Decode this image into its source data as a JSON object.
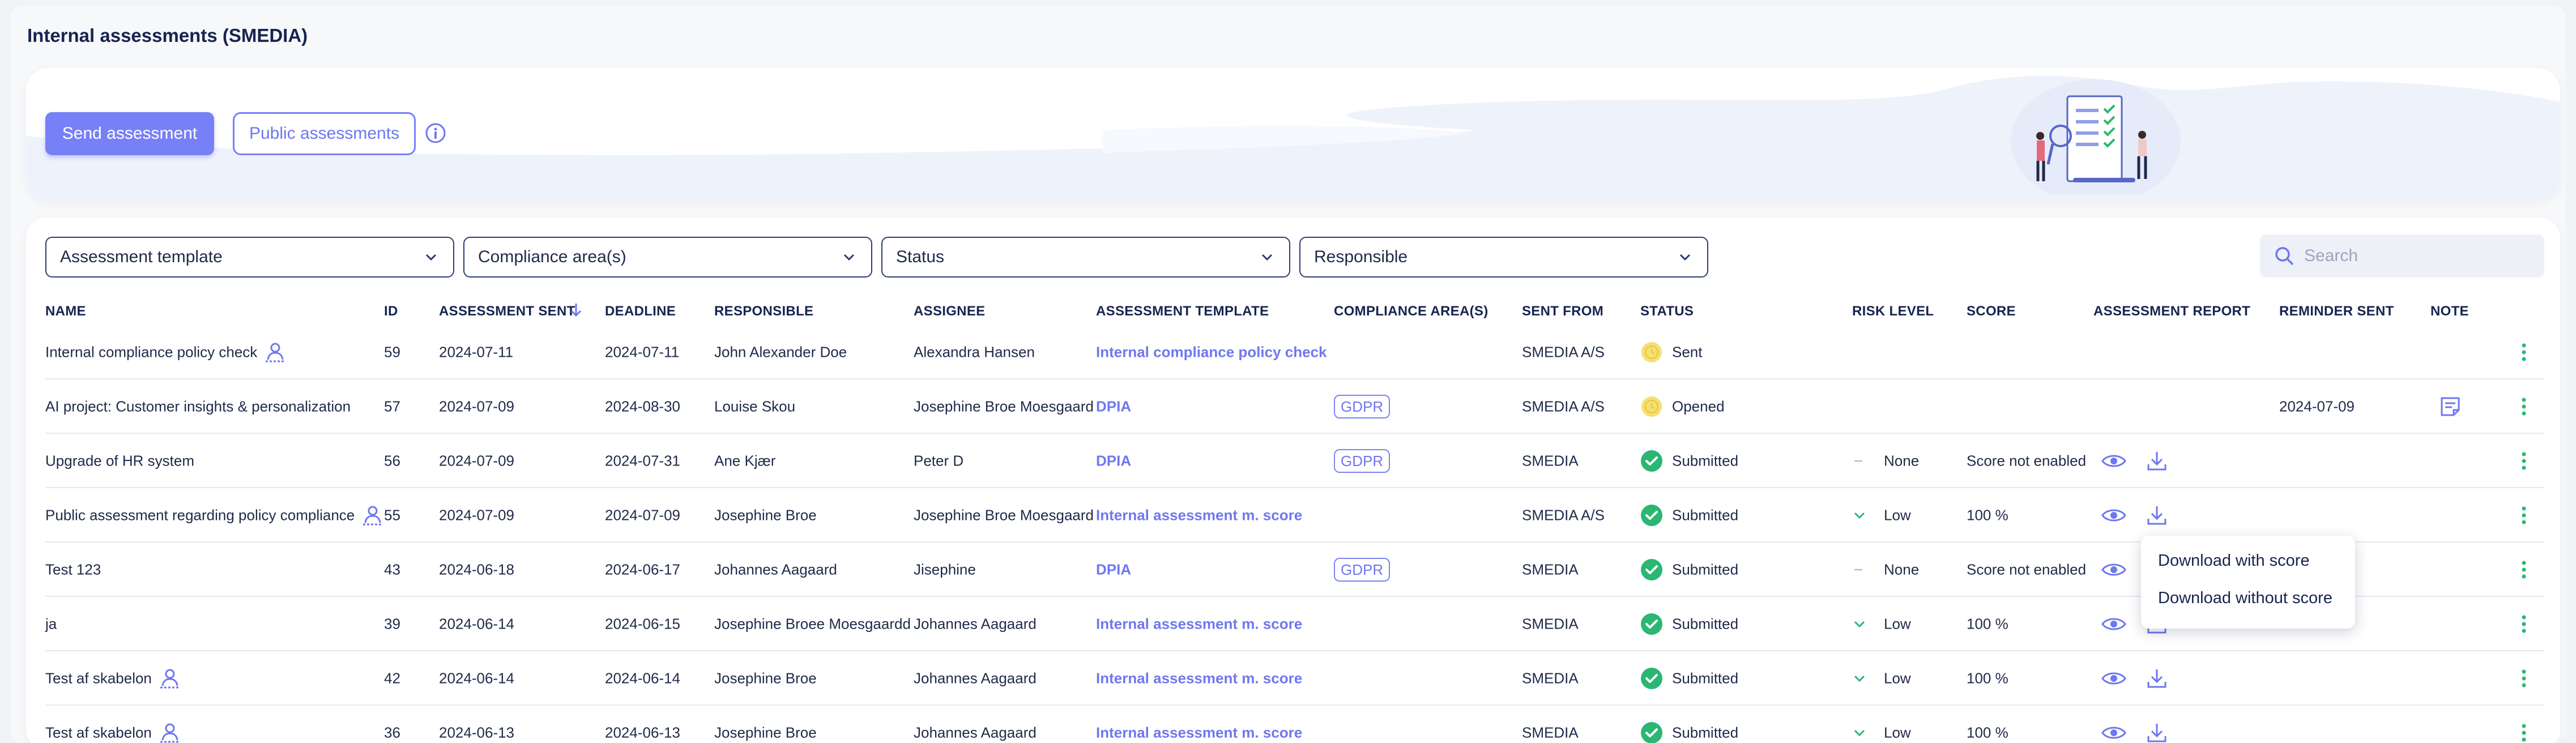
{
  "page": {
    "title": "Internal assessments (SMEDIA)"
  },
  "actions": {
    "send_label": "Send assessment",
    "public_label": "Public assessments"
  },
  "filters": {
    "template": "Assessment template",
    "compliance": "Compliance area(s)",
    "status": "Status",
    "responsible": "Responsible",
    "search_placeholder": "Search"
  },
  "columns": {
    "name": "NAME",
    "id": "ID",
    "sent": "ASSESSMENT SENT",
    "deadline": "DEADLINE",
    "responsible": "RESPONSIBLE",
    "assignee": "ASSIGNEE",
    "template": "ASSESSMENT TEMPLATE",
    "compliance": "COMPLIANCE AREA(S)",
    "sent_from": "SENT FROM",
    "status": "STATUS",
    "risk": "RISK LEVEL",
    "score": "SCORE",
    "report": "ASSESSMENT REPORT",
    "reminder": "REMINDER SENT",
    "note": "NOTE"
  },
  "colors": {
    "accent": "#7780f7",
    "link": "#6f78ef",
    "submitted": "#2bb673",
    "pending": "#f7df72",
    "heading": "#17244f"
  },
  "rows": [
    {
      "name": "Internal compliance policy check",
      "public_icon": "public-user-icon",
      "id": "59",
      "sent": "2024-07-11",
      "deadline": "2024-07-11",
      "responsible": "John Alexander Doe",
      "assignee": "Alexandra Hansen",
      "template": "Internal compliance policy check",
      "compliance": "",
      "sent_from": "SMEDIA A/S",
      "status": "Sent",
      "status_icon": "clock-icon",
      "risk": "",
      "risk_icon": "",
      "score": "",
      "report": false,
      "reminder": "",
      "note": false
    },
    {
      "name": "AI project: Customer insights & personalization",
      "public_icon": "",
      "id": "57",
      "sent": "2024-07-09",
      "deadline": "2024-08-30",
      "responsible": "Louise Skou",
      "assignee": "Josephine Broe Moesgaard",
      "template": "DPIA",
      "compliance": "GDPR",
      "sent_from": "SMEDIA A/S",
      "status": "Opened",
      "status_icon": "clock-icon",
      "risk": "",
      "risk_icon": "",
      "score": "",
      "report": false,
      "reminder": "2024-07-09",
      "note": true
    },
    {
      "name": "Upgrade of HR system",
      "public_icon": "",
      "id": "56",
      "sent": "2024-07-09",
      "deadline": "2024-07-31",
      "responsible": "Ane Kjær",
      "assignee": "Peter D",
      "template": "DPIA",
      "compliance": "GDPR",
      "sent_from": "SMEDIA",
      "status": "Submitted",
      "status_icon": "check-circle-icon",
      "risk": "None",
      "risk_icon": "dash-icon",
      "score": "Score not enabled",
      "report": true,
      "reminder": "",
      "note": false
    },
    {
      "name": "Public assessment regarding policy compliance",
      "public_icon": "public-user-icon",
      "id": "55",
      "sent": "2024-07-09",
      "deadline": "2024-07-09",
      "responsible": "Josephine Broe",
      "assignee": "Josephine Broe Moesgaard",
      "template": "Internal assessment m. score",
      "compliance": "",
      "sent_from": "SMEDIA A/S",
      "status": "Submitted",
      "status_icon": "check-circle-icon",
      "risk": "Low",
      "risk_icon": "chevron-down-icon",
      "score": "100 %",
      "report": true,
      "reminder": "",
      "note": false
    },
    {
      "name": "Test 123",
      "public_icon": "",
      "id": "43",
      "sent": "2024-06-18",
      "deadline": "2024-06-17",
      "responsible": "Johannes Aagaard",
      "assignee": "Jisephine",
      "template": "DPIA",
      "compliance": "GDPR",
      "sent_from": "SMEDIA",
      "status": "Submitted",
      "status_icon": "check-circle-icon",
      "risk": "None",
      "risk_icon": "dash-icon",
      "score": "Score not enabled",
      "report": true,
      "reminder": "",
      "note": false
    },
    {
      "name": "ja",
      "public_icon": "",
      "id": "39",
      "sent": "2024-06-14",
      "deadline": "2024-06-15",
      "responsible": "Josephine Broee Moesgaardd",
      "assignee": "Johannes Aagaard",
      "template": "Internal assessment m. score",
      "compliance": "",
      "sent_from": "SMEDIA",
      "status": "Submitted",
      "status_icon": "check-circle-icon",
      "risk": "Low",
      "risk_icon": "chevron-down-icon",
      "score": "100 %",
      "report": true,
      "reminder": "",
      "note": false
    },
    {
      "name": "Test af skabelon",
      "public_icon": "public-user-icon",
      "id": "42",
      "sent": "2024-06-14",
      "deadline": "2024-06-14",
      "responsible": "Josephine Broe",
      "assignee": "Johannes Aagaard",
      "template": "Internal assessment m. score",
      "compliance": "",
      "sent_from": "SMEDIA",
      "status": "Submitted",
      "status_icon": "check-circle-icon",
      "risk": "Low",
      "risk_icon": "chevron-down-icon",
      "score": "100 %",
      "report": true,
      "reminder": "",
      "note": false
    },
    {
      "name": "Test af skabelon",
      "public_icon": "public-user-icon",
      "id": "36",
      "sent": "2024-06-13",
      "deadline": "2024-06-13",
      "responsible": "Josephine Broe",
      "assignee": "Johannes Aagaard",
      "template": "Internal assessment m. score",
      "compliance": "",
      "sent_from": "SMEDIA",
      "status": "Submitted",
      "status_icon": "check-circle-icon",
      "risk": "Low",
      "risk_icon": "chevron-down-icon",
      "score": "100 %",
      "report": true,
      "reminder": "",
      "note": false
    }
  ],
  "download_menu": {
    "with_score": "Download with score",
    "without_score": "Download without score"
  }
}
